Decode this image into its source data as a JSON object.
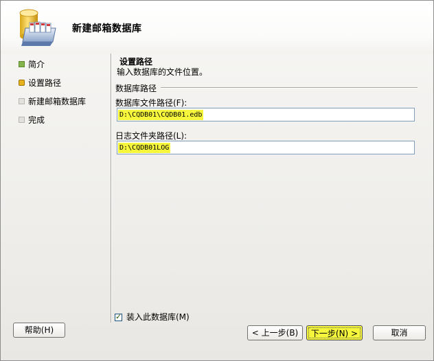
{
  "header": {
    "title": "新建邮箱数据库",
    "icon": "mailbox-database-icon"
  },
  "nav": {
    "items": [
      {
        "label": "简介",
        "state": "done"
      },
      {
        "label": "设置路径",
        "state": "current"
      },
      {
        "label": "新建邮箱数据库",
        "state": "todo"
      },
      {
        "label": "完成",
        "state": "todo"
      }
    ]
  },
  "page": {
    "title": "设置路径",
    "description": "输入数据库的文件位置。",
    "section_label": "数据库路径",
    "db_file_label": "数据库文件路径(F):",
    "db_file_value": "D:\\CQDB01\\CQDB01.edb",
    "log_folder_label": "日志文件夹路径(L):",
    "log_folder_value": "D:\\CQDB01LOG",
    "mount_label": "装入此数据库(M)",
    "mount_checked": true
  },
  "buttons": {
    "help": "帮助(H)",
    "back": "< 上一步(B)",
    "next": "下一步(N) >",
    "cancel": "取消"
  },
  "colors": {
    "highlight": "#f6f63c",
    "nav_done": "#86b44c",
    "nav_current": "#e6b21d",
    "nav_todo": "#e2e1de"
  }
}
